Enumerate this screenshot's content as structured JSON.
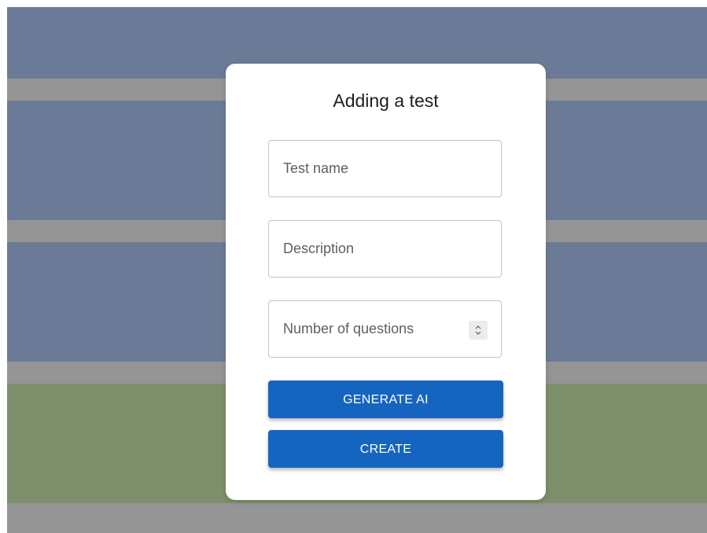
{
  "dialog": {
    "title": "Adding a test",
    "fields": {
      "test_name": {
        "value": "",
        "placeholder": "Test name"
      },
      "description": {
        "value": "",
        "placeholder": "Description"
      },
      "num_questions": {
        "value": "",
        "placeholder": "Number of questions"
      }
    },
    "buttons": {
      "generate_ai": "GENERATE AI",
      "create": "CREATE"
    }
  },
  "colors": {
    "primary": "#1565c0",
    "backdrop_blue": "#6b7b97",
    "backdrop_green": "#7e8f6b",
    "backdrop_gray": "#959595"
  },
  "icons": {
    "spinner": "up-down-chevron-icon"
  }
}
